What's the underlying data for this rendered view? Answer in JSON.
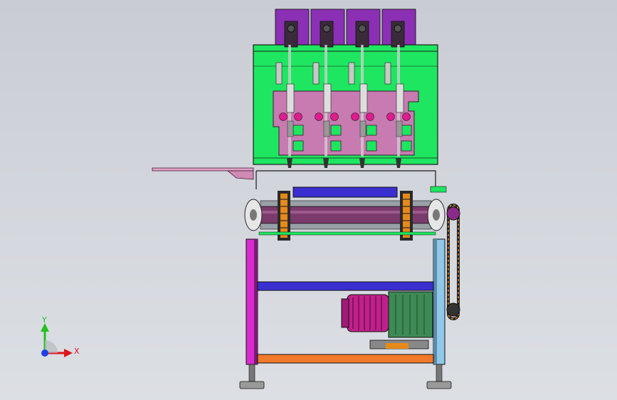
{
  "viewport": {
    "background": "#d0d3d9"
  },
  "triad": {
    "x_label": "X",
    "y_label": "Y",
    "x_color": "#e0141e",
    "y_color": "#21c21f",
    "z_color": "#1f3ee6"
  },
  "machine": {
    "spindle_units": 4,
    "colors": {
      "frame_green": "#1ee660",
      "plate_pink": "#c77bb0",
      "purple_box": "#8b2fb5",
      "magenta_leg": "#d92bd0",
      "blue_beam": "#3a2fd0",
      "orange_beam": "#f07a2a",
      "motor_magenta": "#c0208a",
      "gearbox_green": "#3d8a55",
      "roller": "#7b3a6c",
      "chain_orange": "#e58a1a",
      "light_blue_leg": "#8fc8e8"
    }
  }
}
